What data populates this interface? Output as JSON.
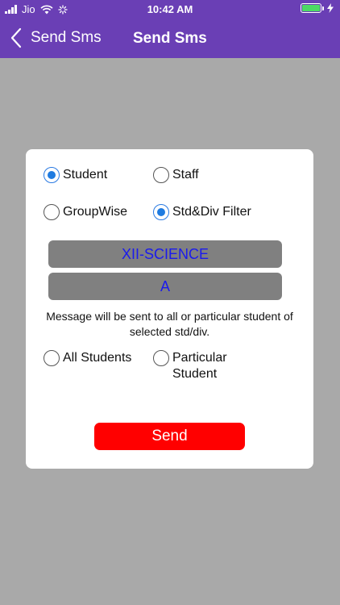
{
  "status_bar": {
    "carrier": "Jio",
    "time": "10:42 AM"
  },
  "nav": {
    "back_label": "Send Sms",
    "title": "Send Sms"
  },
  "form": {
    "recipient_options": [
      {
        "label": "Student",
        "checked": true
      },
      {
        "label": "Staff",
        "checked": false
      },
      {
        "label": "GroupWise",
        "checked": false
      },
      {
        "label": "Std&Div Filter",
        "checked": true
      }
    ],
    "std_value": "XII-SCIENCE",
    "div_value": "A",
    "info_text": "Message will be sent to all or particular student of selected std/div.",
    "scope_options": [
      {
        "label": "All Students",
        "checked": false
      },
      {
        "label": "Particular Student",
        "checked": false
      }
    ],
    "send_label": "Send"
  },
  "colors": {
    "header": "#6a3fb5",
    "background": "#a9a9a9",
    "radio_checked": "#1f7be0",
    "dropdown_bg": "#808080",
    "dropdown_text": "#1a1aee",
    "send_button": "#ff0000"
  }
}
